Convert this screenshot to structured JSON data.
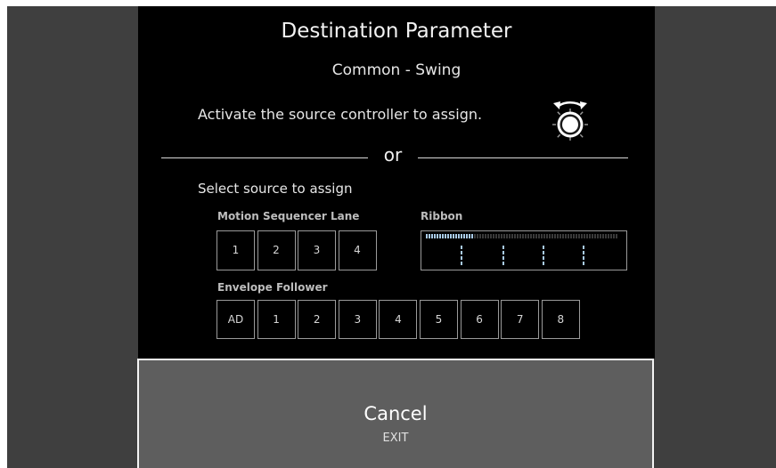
{
  "dialog": {
    "title": "Destination Parameter",
    "subtitle": "Common - Swing",
    "instruction": "Activate the source controller to assign.",
    "or_label": "or",
    "select_label": "Select source to assign"
  },
  "motion_sequencer": {
    "label": "Motion Sequencer Lane",
    "lanes": [
      "1",
      "2",
      "3",
      "4"
    ]
  },
  "ribbon": {
    "label": "Ribbon",
    "level": 0.25
  },
  "envelope_follower": {
    "label": "Envelope Follower",
    "items": [
      "AD",
      "1",
      "2",
      "3",
      "4",
      "5",
      "6",
      "7",
      "8"
    ]
  },
  "cancel": {
    "label": "Cancel",
    "shortcut": "EXIT"
  },
  "colors": {
    "background": "#3f3f3f",
    "dialog": "#000000",
    "cancel_panel": "#5e5e5e",
    "ribbon_active": "#a9cbe8"
  },
  "icons": {
    "controller": "knob-rotate-icon"
  }
}
